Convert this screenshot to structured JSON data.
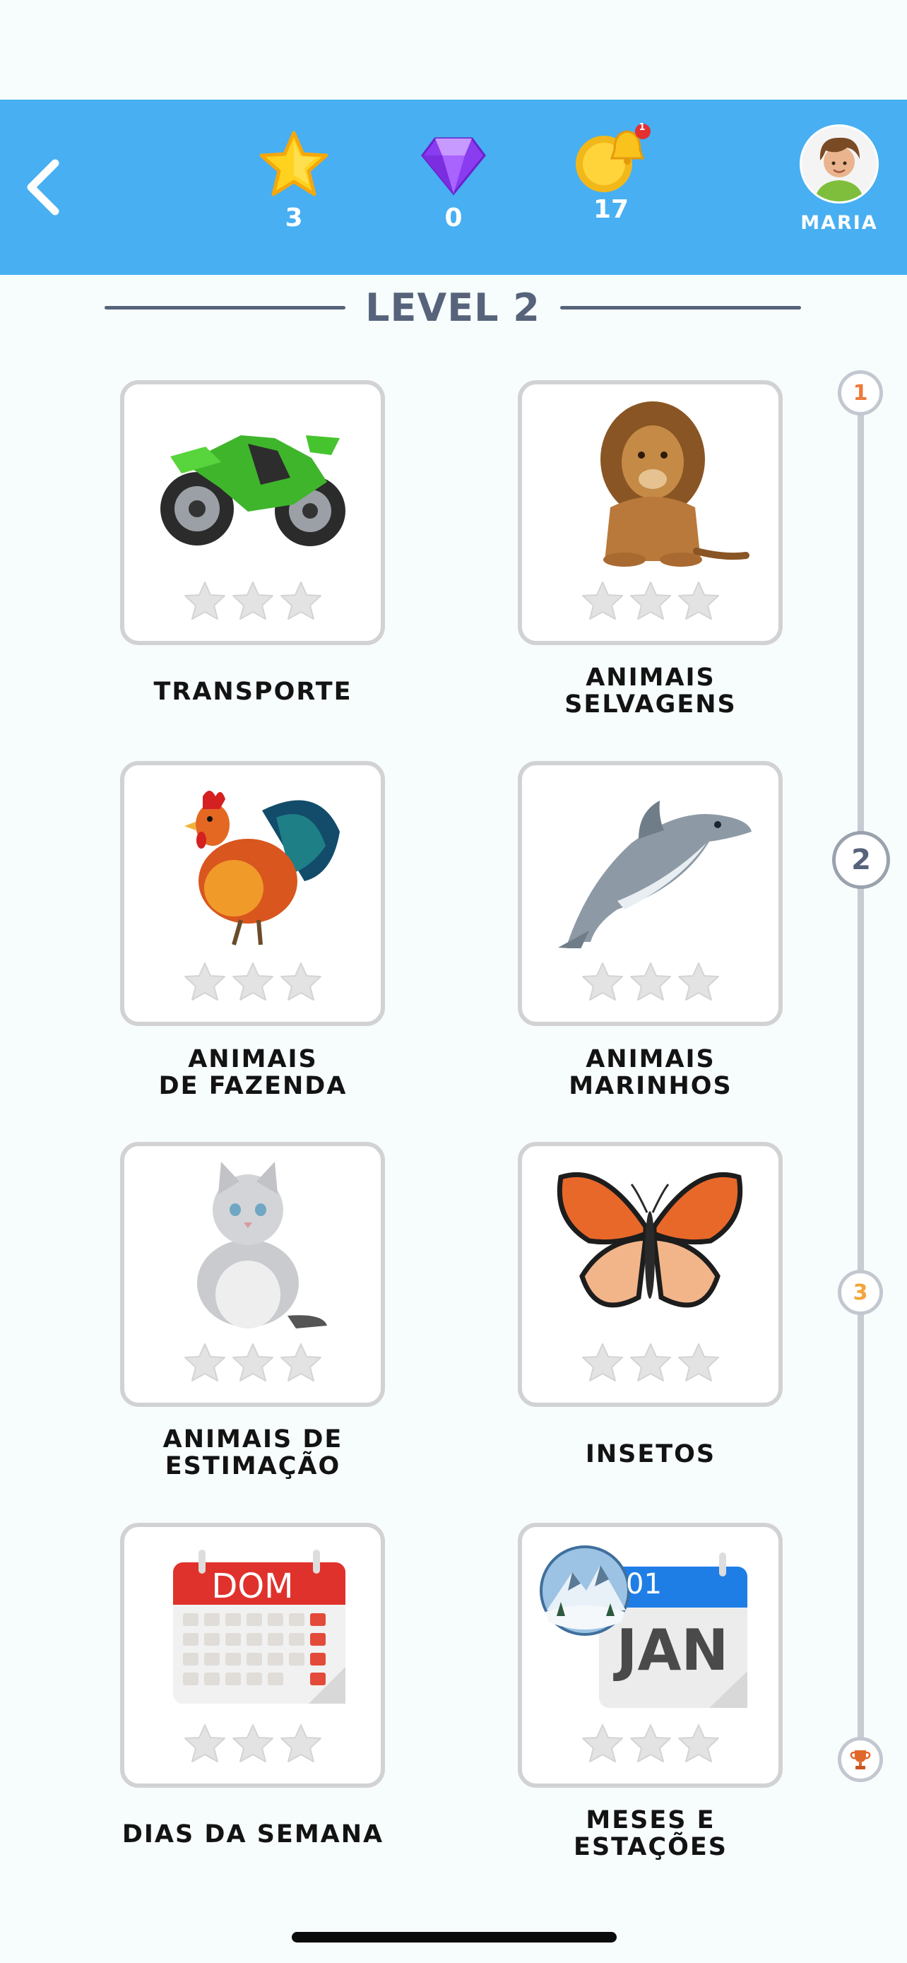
{
  "header": {
    "stars_count": "3",
    "gems_count": "0",
    "coins_count": "17",
    "notification_badge": "1",
    "user_name": "MARIA"
  },
  "level": {
    "title": "LEVEL 2"
  },
  "categories": [
    {
      "label": "TRANSPORTE",
      "icon": "motorcycle-icon",
      "stars_earned": 0
    },
    {
      "label": "ANIMAIS\nSELVAGENS",
      "icon": "lion-icon",
      "stars_earned": 0
    },
    {
      "label": "ANIMAIS\nDE FAZENDA",
      "icon": "rooster-icon",
      "stars_earned": 0
    },
    {
      "label": "ANIMAIS\nMARINHOS",
      "icon": "dolphin-icon",
      "stars_earned": 0
    },
    {
      "label": "ANIMAIS DE\nESTIMAÇÃO",
      "icon": "cat-icon",
      "stars_earned": 0
    },
    {
      "label": "INSETOS",
      "icon": "butterfly-icon",
      "stars_earned": 0
    },
    {
      "label": "DIAS DA SEMANA",
      "icon": "weekday-calendar-icon",
      "stars_earned": 0,
      "calendar_text": "DOM"
    },
    {
      "label": "MESES E\nESTAÇÕES",
      "icon": "month-calendar-icon",
      "stars_earned": 0,
      "calendar_day": "01",
      "calendar_month": "JAN"
    }
  ],
  "progress": {
    "milestones": [
      "1",
      "2",
      "3"
    ],
    "final_icon": "trophy-icon"
  },
  "colors": {
    "header_bg": "#47aff2",
    "milestone_1": "#ee7a3b",
    "milestone_2": "#56637a",
    "milestone_3": "#f2a53a",
    "calendar_red": "#e0322c",
    "calendar_blue": "#1f7ee6"
  }
}
